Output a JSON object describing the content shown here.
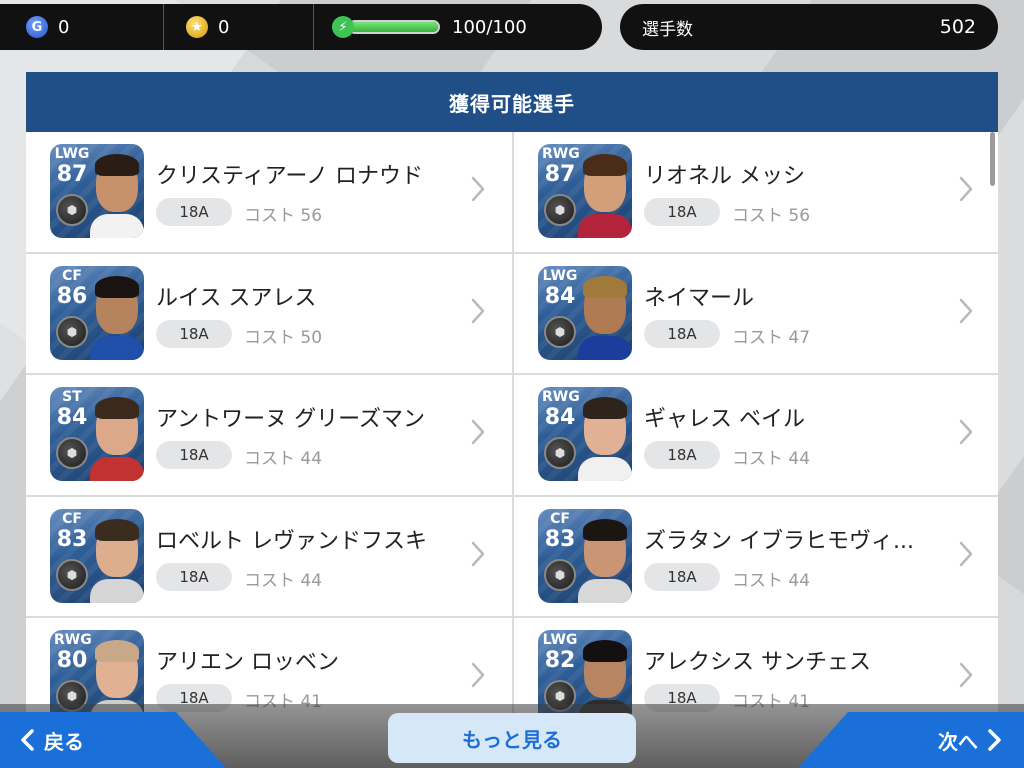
{
  "topbar": {
    "gp_icon": "G",
    "gp_value": "0",
    "coin_icon": "★",
    "coin_value": "0",
    "stamina_icon": "⚡",
    "stamina_text": "100/100",
    "stamina_fraction": 1.0
  },
  "player_count": {
    "label": "選手数",
    "value": "502"
  },
  "panel": {
    "title": "獲得可能選手"
  },
  "players": [
    {
      "pos": "LWG",
      "ovr": "87",
      "name": "クリスティアーノ ロナウド",
      "version": "18A",
      "cost": "コスト 56",
      "hair": "#2a1d15",
      "skin": "#c7916c",
      "shirt": "#f2f2f2"
    },
    {
      "pos": "RWG",
      "ovr": "87",
      "name": "リオネル メッシ",
      "version": "18A",
      "cost": "コスト 56",
      "hair": "#4a2c18",
      "skin": "#d39f7b",
      "shirt": "#b3243a"
    },
    {
      "pos": "CF",
      "ovr": "86",
      "name": "ルイス スアレス",
      "version": "18A",
      "cost": "コスト 50",
      "hair": "#1a1410",
      "skin": "#b5835d",
      "shirt": "#1f4fa8"
    },
    {
      "pos": "LWG",
      "ovr": "84",
      "name": "ネイマール",
      "version": "18A",
      "cost": "コスト 47",
      "hair": "#a07a3a",
      "skin": "#b07a53",
      "shirt": "#1b3e9c"
    },
    {
      "pos": "ST",
      "ovr": "84",
      "name": "アントワーヌ グリーズマン",
      "version": "18A",
      "cost": "コスト 44",
      "hair": "#3a2a1e",
      "skin": "#dba98a",
      "shirt": "#c23232"
    },
    {
      "pos": "RWG",
      "ovr": "84",
      "name": "ギャレス ベイル",
      "version": "18A",
      "cost": "コスト 44",
      "hair": "#2f241b",
      "skin": "#e0b194",
      "shirt": "#f0f0f0"
    },
    {
      "pos": "CF",
      "ovr": "83",
      "name": "ロベルト レヴァンドフスキ",
      "version": "18A",
      "cost": "コスト 44",
      "hair": "#3b2c20",
      "skin": "#dcae8e",
      "shirt": "#d5d5d5"
    },
    {
      "pos": "CF",
      "ovr": "83",
      "name": "ズラタン イブラヒモヴィ...",
      "version": "18A",
      "cost": "コスト 44",
      "hair": "#1c1612",
      "skin": "#c99574",
      "shirt": "#d8d8d8"
    },
    {
      "pos": "RWG",
      "ovr": "80",
      "name": "アリエン ロッベン",
      "version": "18A",
      "cost": "コスト 41",
      "hair": "#c9a88a",
      "skin": "#e0b193",
      "shirt": "#cccccc"
    },
    {
      "pos": "LWG",
      "ovr": "82",
      "name": "アレクシス サンチェス",
      "version": "18A",
      "cost": "コスト 41",
      "hair": "#151010",
      "skin": "#b78561",
      "shirt": "#2d2d2d"
    }
  ],
  "bottom": {
    "back_label": "戻る",
    "more_label": "もっと見る",
    "next_label": "次へ"
  }
}
